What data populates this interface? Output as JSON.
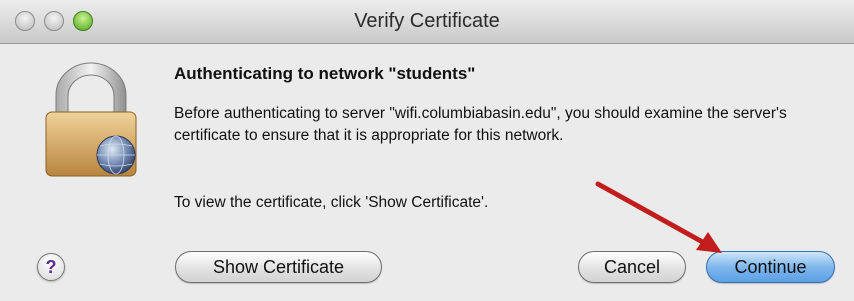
{
  "window": {
    "title": "Verify Certificate"
  },
  "dialog": {
    "heading": "Authenticating to network \"students\"",
    "body": "Before authenticating to server \"wifi.columbiabasin.edu\", you should examine the server's certificate to ensure that it is appropriate for this network.",
    "instruction": "To view the certificate, click 'Show Certificate'."
  },
  "buttons": {
    "help": "?",
    "show_certificate": "Show Certificate",
    "cancel": "Cancel",
    "continue": "Continue"
  },
  "icons": {
    "lock": "lock-icon",
    "globe": "globe-icon"
  },
  "colors": {
    "annotation_arrow": "#c21d1d",
    "default_button": "#5b9fe6"
  }
}
